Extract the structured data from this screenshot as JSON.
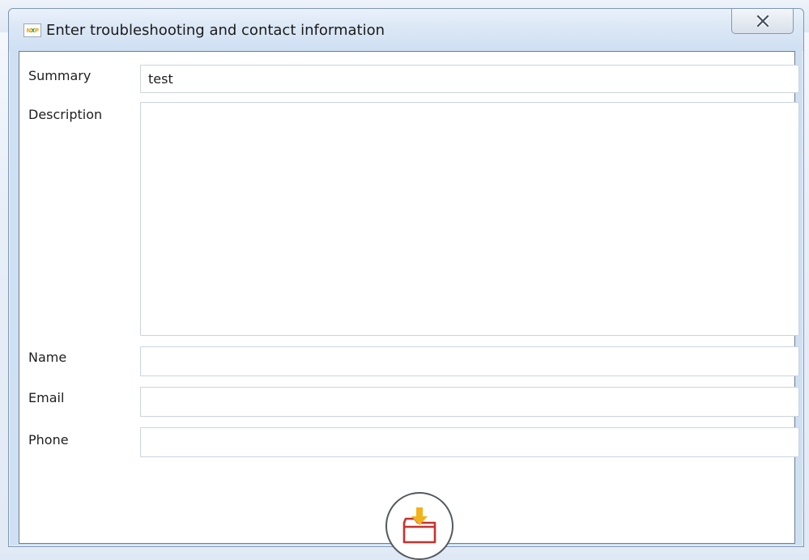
{
  "window": {
    "title": "Enter troubleshooting and contact information",
    "app_icon_letters": [
      "N",
      "X",
      "P"
    ]
  },
  "form": {
    "summary": {
      "label": "Summary",
      "value": "test"
    },
    "description": {
      "label": "Description",
      "value": ""
    },
    "name": {
      "label": "Name",
      "value": ""
    },
    "email": {
      "label": "Email",
      "value": ""
    },
    "phone": {
      "label": "Phone",
      "value": ""
    }
  },
  "icons": {
    "close": "close-icon",
    "submit": "download-to-folder-icon"
  },
  "colors": {
    "arrow": "#f3b21a",
    "folder": "#c9312c",
    "button_ring": "#555a60"
  }
}
